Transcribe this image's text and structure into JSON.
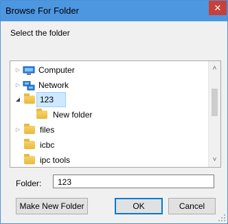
{
  "dialog": {
    "title": "Browse For Folder",
    "close_symbol": "✕",
    "prompt": "Select the folder"
  },
  "tree": {
    "items": [
      {
        "label": "Computer",
        "icon": "computer-icon",
        "expander": "collapsed"
      },
      {
        "label": "Network",
        "icon": "network-icon",
        "expander": "collapsed"
      },
      {
        "label": "123",
        "icon": "folder-icon",
        "expander": "expanded",
        "selected": true
      },
      {
        "label": "New folder",
        "icon": "folder-icon",
        "expander": "none"
      },
      {
        "label": "files",
        "icon": "folder-icon",
        "expander": "collapsed"
      },
      {
        "label": "icbc",
        "icon": "folder-icon",
        "expander": "none"
      },
      {
        "label": "ipc tools",
        "icon": "folder-icon",
        "expander": "none"
      }
    ],
    "glyphs": {
      "collapsed": "▷",
      "expanded": "◢",
      "up": "˄",
      "down": "˅"
    }
  },
  "folder_field": {
    "label": "Folder:",
    "value": "123"
  },
  "buttons": {
    "make_new_folder": "Make New Folder",
    "ok": "OK",
    "cancel": "Cancel"
  },
  "colors": {
    "titlebar": "#4d96e0",
    "close": "#c8403a",
    "selection": "#cde8ff",
    "folder": "#e8b93f"
  }
}
